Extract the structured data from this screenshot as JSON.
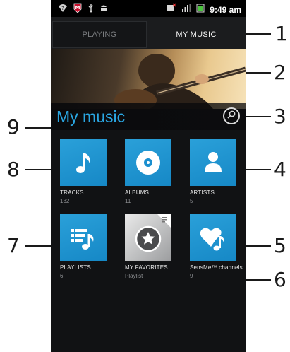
{
  "status_bar": {
    "time": "9:49 am",
    "icons": [
      "wifi-question-icon",
      "mcafee-icon",
      "usb-icon",
      "android-debug-icon",
      "sms-missed-icon",
      "signal-icon",
      "battery-icon"
    ]
  },
  "tabs": [
    {
      "label": "PLAYING",
      "selected": false
    },
    {
      "label": "MY MUSIC",
      "selected": true
    }
  ],
  "header": {
    "title": "My music"
  },
  "tiles": [
    {
      "label": "TRACKS",
      "count": "132",
      "icon": "music-note-icon"
    },
    {
      "label": "ALBUMS",
      "count": "11",
      "icon": "disc-icon"
    },
    {
      "label": "ARTISTS",
      "count": "5",
      "icon": "person-icon"
    },
    {
      "label": "PLAYLISTS",
      "count": "6",
      "icon": "playlist-icon"
    },
    {
      "label": "MY FAVORITES",
      "count": "Playlist",
      "icon": "star-icon"
    },
    {
      "label": "SensMe™ channels",
      "count": "9",
      "icon": "heart-note-icon"
    }
  ],
  "callouts": [
    "1",
    "2",
    "3",
    "4",
    "5",
    "6",
    "7",
    "8",
    "9"
  ],
  "colors": {
    "accent": "#2aa7e3",
    "tile": "#1a8fcf",
    "background": "#111214"
  }
}
